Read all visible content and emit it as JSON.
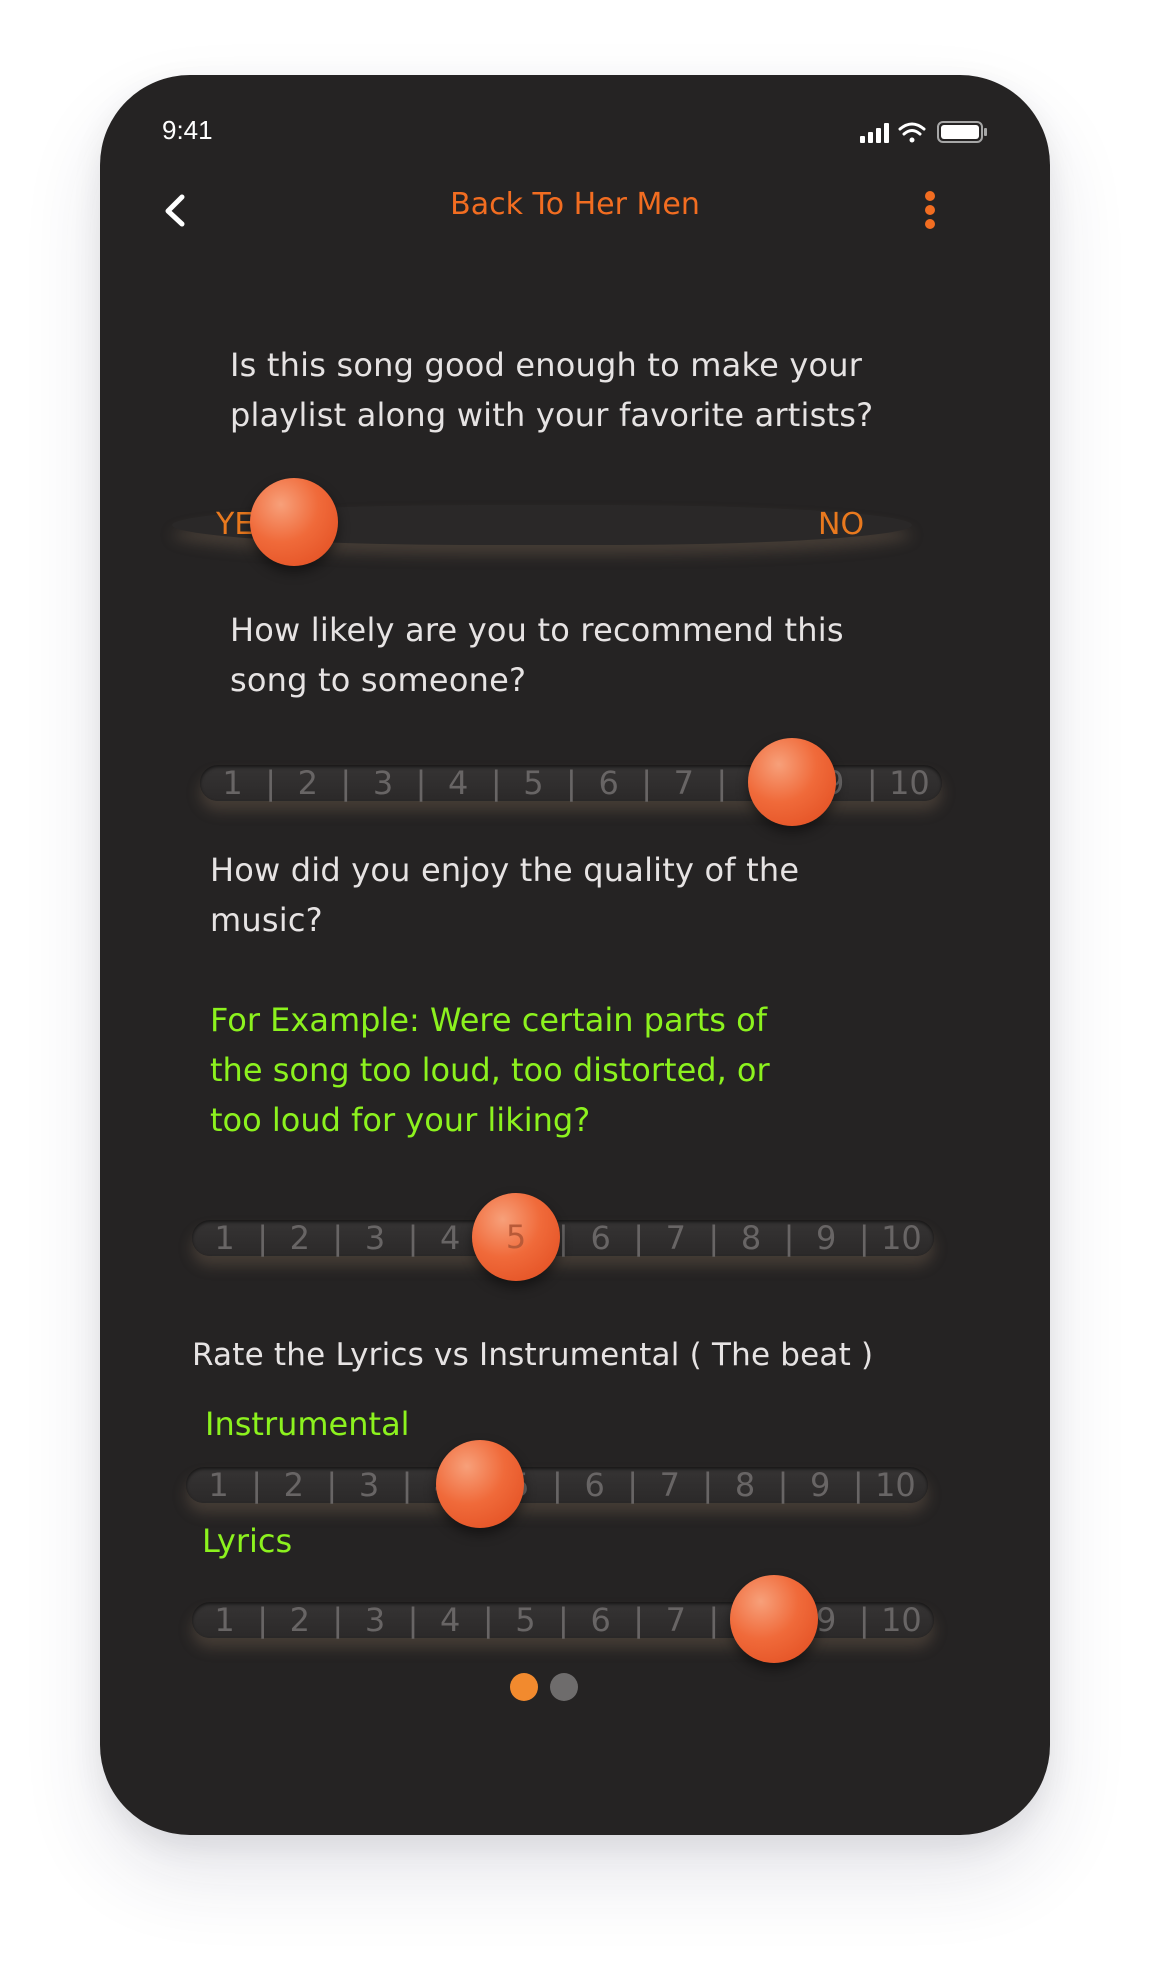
{
  "status_bar": {
    "time": "9:41"
  },
  "nav": {
    "title": "Back To Her Men"
  },
  "colors": {
    "accent": "#f26d21",
    "hint": "#8cf21e",
    "background": "#252323"
  },
  "questions": {
    "q1": {
      "text": "Is this song good enough to make your playlist along with your favorite artists?",
      "line1": "Is this song good enough to make your",
      "line2": "playlist along with your favorite artists?",
      "yes_label": "YE",
      "no_label": "NO",
      "selected": "YES"
    },
    "q2": {
      "line1": "How likely are you to recommend this",
      "line2": "song to someone?",
      "scale": [
        "1",
        "2",
        "3",
        "4",
        "5",
        "6",
        "7",
        "8",
        "9",
        "10"
      ],
      "selected": 9
    },
    "q3": {
      "line1": "How did you enjoy the quality of the",
      "line2": "music?",
      "hint_line1": "For Example: Were certain parts of",
      "hint_line2": "the song too loud, too distorted, or",
      "hint_line3": "too loud for your liking?",
      "scale": [
        "1",
        "2",
        "3",
        "4",
        "5",
        "6",
        "7",
        "8",
        "9",
        "10"
      ],
      "selected": 5
    },
    "q4": {
      "text": "Rate the Lyrics vs Instrumental ( The beat )",
      "instrumental_label": "Instrumental",
      "lyrics_label": "Lyrics",
      "instrumental_scale": [
        "1",
        "2",
        "3",
        "4",
        "5",
        "6",
        "7",
        "8",
        "9",
        "10"
      ],
      "instrumental_selected": 5,
      "lyrics_scale": [
        "1",
        "2",
        "3",
        "4",
        "5",
        "6",
        "7",
        "8",
        "9",
        "10"
      ],
      "lyrics_selected": 8.5
    }
  },
  "pagination": {
    "pages": 2,
    "current": 1
  }
}
